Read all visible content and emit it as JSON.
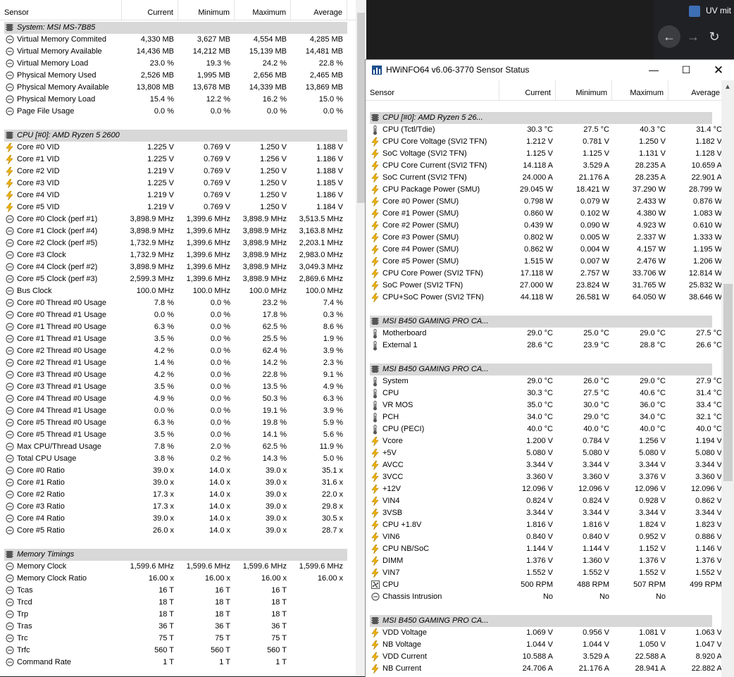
{
  "colors": {
    "group_bg": "#d8d8d8",
    "volt_icon": "#f0b400",
    "temp_icon": "#555555"
  },
  "browser": {
    "tab_title": "UV mit"
  },
  "winA": {
    "headers": [
      "Sensor",
      "Current",
      "Minimum",
      "Maximum",
      "Average"
    ],
    "rows": [
      {
        "t": "g",
        "icon": "chip-icon",
        "s": "System: MSI MS-7B85"
      },
      {
        "icon": "circle-icon",
        "s": "Virtual Memory Commited",
        "v": [
          "4,330 MB",
          "3,627 MB",
          "4,554 MB",
          "4,285 MB"
        ]
      },
      {
        "icon": "circle-icon",
        "s": "Virtual Memory Available",
        "v": [
          "14,436 MB",
          "14,212 MB",
          "15,139 MB",
          "14,481 MB"
        ]
      },
      {
        "icon": "circle-icon",
        "s": "Virtual Memory Load",
        "v": [
          "23.0 %",
          "19.3 %",
          "24.2 %",
          "22.8 %"
        ]
      },
      {
        "icon": "circle-icon",
        "s": "Physical Memory Used",
        "v": [
          "2,526 MB",
          "1,995 MB",
          "2,656 MB",
          "2,465 MB"
        ]
      },
      {
        "icon": "circle-icon",
        "s": "Physical Memory Available",
        "v": [
          "13,808 MB",
          "13,678 MB",
          "14,339 MB",
          "13,869 MB"
        ]
      },
      {
        "icon": "circle-icon",
        "s": "Physical Memory Load",
        "v": [
          "15.4 %",
          "12.2 %",
          "16.2 %",
          "15.0 %"
        ]
      },
      {
        "icon": "circle-icon",
        "s": "Page File Usage",
        "v": [
          "0.0 %",
          "0.0 %",
          "0.0 %",
          "0.0 %"
        ]
      },
      {
        "t": "b"
      },
      {
        "t": "g",
        "icon": "chip-icon",
        "s": "CPU [#0]: AMD Ryzen 5 2600"
      },
      {
        "icon": "bolt-icon",
        "s": "Core #0 VID",
        "v": [
          "1.225 V",
          "0.769 V",
          "1.250 V",
          "1.188 V"
        ]
      },
      {
        "icon": "bolt-icon",
        "s": "Core #1 VID",
        "v": [
          "1.225 V",
          "0.769 V",
          "1.256 V",
          "1.186 V"
        ]
      },
      {
        "icon": "bolt-icon",
        "s": "Core #2 VID",
        "v": [
          "1.219 V",
          "0.769 V",
          "1.250 V",
          "1.188 V"
        ]
      },
      {
        "icon": "bolt-icon",
        "s": "Core #3 VID",
        "v": [
          "1.225 V",
          "0.769 V",
          "1.250 V",
          "1.185 V"
        ]
      },
      {
        "icon": "bolt-icon",
        "s": "Core #4 VID",
        "v": [
          "1.219 V",
          "0.769 V",
          "1.250 V",
          "1.186 V"
        ]
      },
      {
        "icon": "bolt-icon",
        "s": "Core #5 VID",
        "v": [
          "1.219 V",
          "0.769 V",
          "1.250 V",
          "1.184 V"
        ]
      },
      {
        "icon": "circle-icon",
        "s": "Core #0 Clock (perf #1)",
        "v": [
          "3,898.9 MHz",
          "1,399.6 MHz",
          "3,898.9 MHz",
          "3,513.5 MHz"
        ]
      },
      {
        "icon": "circle-icon",
        "s": "Core #1 Clock (perf #4)",
        "v": [
          "3,898.9 MHz",
          "1,399.6 MHz",
          "3,898.9 MHz",
          "3,163.8 MHz"
        ]
      },
      {
        "icon": "circle-icon",
        "s": "Core #2 Clock (perf #5)",
        "v": [
          "1,732.9 MHz",
          "1,399.6 MHz",
          "3,898.9 MHz",
          "2,203.1 MHz"
        ]
      },
      {
        "icon": "circle-icon",
        "s": "Core #3 Clock",
        "v": [
          "1,732.9 MHz",
          "1,399.6 MHz",
          "3,898.9 MHz",
          "2,983.0 MHz"
        ]
      },
      {
        "icon": "circle-icon",
        "s": "Core #4 Clock (perf #2)",
        "v": [
          "3,898.9 MHz",
          "1,399.6 MHz",
          "3,898.9 MHz",
          "3,049.3 MHz"
        ]
      },
      {
        "icon": "circle-icon",
        "s": "Core #5 Clock (perf #3)",
        "v": [
          "2,599.3 MHz",
          "1,399.6 MHz",
          "3,898.9 MHz",
          "2,869.6 MHz"
        ]
      },
      {
        "icon": "circle-icon",
        "s": "Bus Clock",
        "v": [
          "100.0 MHz",
          "100.0 MHz",
          "100.0 MHz",
          "100.0 MHz"
        ]
      },
      {
        "icon": "circle-icon",
        "s": "Core #0 Thread #0 Usage",
        "v": [
          "7.8 %",
          "0.0 %",
          "23.2 %",
          "7.4 %"
        ]
      },
      {
        "icon": "circle-icon",
        "s": "Core #0 Thread #1 Usage",
        "v": [
          "0.0 %",
          "0.0 %",
          "17.8 %",
          "0.3 %"
        ]
      },
      {
        "icon": "circle-icon",
        "s": "Core #1 Thread #0 Usage",
        "v": [
          "6.3 %",
          "0.0 %",
          "62.5 %",
          "8.6 %"
        ]
      },
      {
        "icon": "circle-icon",
        "s": "Core #1 Thread #1 Usage",
        "v": [
          "3.5 %",
          "0.0 %",
          "25.5 %",
          "1.9 %"
        ]
      },
      {
        "icon": "circle-icon",
        "s": "Core #2 Thread #0 Usage",
        "v": [
          "4.2 %",
          "0.0 %",
          "62.4 %",
          "3.9 %"
        ]
      },
      {
        "icon": "circle-icon",
        "s": "Core #2 Thread #1 Usage",
        "v": [
          "1.4 %",
          "0.0 %",
          "14.2 %",
          "2.3 %"
        ]
      },
      {
        "icon": "circle-icon",
        "s": "Core #3 Thread #0 Usage",
        "v": [
          "4.2 %",
          "0.0 %",
          "22.8 %",
          "9.1 %"
        ]
      },
      {
        "icon": "circle-icon",
        "s": "Core #3 Thread #1 Usage",
        "v": [
          "3.5 %",
          "0.0 %",
          "13.5 %",
          "4.9 %"
        ]
      },
      {
        "icon": "circle-icon",
        "s": "Core #4 Thread #0 Usage",
        "v": [
          "4.9 %",
          "0.0 %",
          "50.3 %",
          "6.3 %"
        ]
      },
      {
        "icon": "circle-icon",
        "s": "Core #4 Thread #1 Usage",
        "v": [
          "0.0 %",
          "0.0 %",
          "19.1 %",
          "3.9 %"
        ]
      },
      {
        "icon": "circle-icon",
        "s": "Core #5 Thread #0 Usage",
        "v": [
          "6.3 %",
          "0.0 %",
          "19.8 %",
          "5.9 %"
        ]
      },
      {
        "icon": "circle-icon",
        "s": "Core #5 Thread #1 Usage",
        "v": [
          "3.5 %",
          "0.0 %",
          "14.1 %",
          "5.6 %"
        ]
      },
      {
        "icon": "circle-icon",
        "s": "Max CPU/Thread Usage",
        "v": [
          "7.8 %",
          "2.0 %",
          "62.5 %",
          "11.9 %"
        ]
      },
      {
        "icon": "circle-icon",
        "s": "Total CPU Usage",
        "v": [
          "3.8 %",
          "0.2 %",
          "14.3 %",
          "5.0 %"
        ]
      },
      {
        "icon": "circle-icon",
        "s": "Core #0 Ratio",
        "v": [
          "39.0 x",
          "14.0 x",
          "39.0 x",
          "35.1 x"
        ]
      },
      {
        "icon": "circle-icon",
        "s": "Core #1 Ratio",
        "v": [
          "39.0 x",
          "14.0 x",
          "39.0 x",
          "31.6 x"
        ]
      },
      {
        "icon": "circle-icon",
        "s": "Core #2 Ratio",
        "v": [
          "17.3 x",
          "14.0 x",
          "39.0 x",
          "22.0 x"
        ]
      },
      {
        "icon": "circle-icon",
        "s": "Core #3 Ratio",
        "v": [
          "17.3 x",
          "14.0 x",
          "39.0 x",
          "29.8 x"
        ]
      },
      {
        "icon": "circle-icon",
        "s": "Core #4 Ratio",
        "v": [
          "39.0 x",
          "14.0 x",
          "39.0 x",
          "30.5 x"
        ]
      },
      {
        "icon": "circle-icon",
        "s": "Core #5 Ratio",
        "v": [
          "26.0 x",
          "14.0 x",
          "39.0 x",
          "28.7 x"
        ]
      },
      {
        "t": "b"
      },
      {
        "t": "g",
        "icon": "chip-icon",
        "s": "Memory Timings"
      },
      {
        "icon": "circle-icon",
        "s": "Memory Clock",
        "v": [
          "1,599.6 MHz",
          "1,599.6 MHz",
          "1,599.6 MHz",
          "1,599.6 MHz"
        ]
      },
      {
        "icon": "circle-icon",
        "s": "Memory Clock Ratio",
        "v": [
          "16.00 x",
          "16.00 x",
          "16.00 x",
          "16.00 x"
        ]
      },
      {
        "icon": "circle-icon",
        "s": "Tcas",
        "v": [
          "16 T",
          "16 T",
          "16 T",
          ""
        ]
      },
      {
        "icon": "circle-icon",
        "s": "Trcd",
        "v": [
          "18 T",
          "18 T",
          "18 T",
          ""
        ]
      },
      {
        "icon": "circle-icon",
        "s": "Trp",
        "v": [
          "18 T",
          "18 T",
          "18 T",
          ""
        ]
      },
      {
        "icon": "circle-icon",
        "s": "Tras",
        "v": [
          "36 T",
          "36 T",
          "36 T",
          ""
        ]
      },
      {
        "icon": "circle-icon",
        "s": "Trc",
        "v": [
          "75 T",
          "75 T",
          "75 T",
          ""
        ]
      },
      {
        "icon": "circle-icon",
        "s": "Trfc",
        "v": [
          "560 T",
          "560 T",
          "560 T",
          ""
        ]
      },
      {
        "icon": "circle-icon",
        "s": "Command Rate",
        "v": [
          "1 T",
          "1 T",
          "1 T",
          ""
        ]
      }
    ]
  },
  "winB": {
    "title": "HWiNFO64 v6.06-3770 Sensor Status",
    "headers": [
      "Sensor",
      "Current",
      "Minimum",
      "Maximum",
      "Average"
    ],
    "rows": [
      {
        "t": "g",
        "icon": "chip-icon",
        "s": "CPU [#0]: AMD Ryzen 5 26..."
      },
      {
        "icon": "thermometer-icon",
        "s": "CPU (Tctl/Tdie)",
        "v": [
          "30.3 °C",
          "27.5 °C",
          "40.3 °C",
          "31.4 °C"
        ]
      },
      {
        "icon": "bolt-icon",
        "s": "CPU Core Voltage (SVI2 TFN)",
        "v": [
          "1.212 V",
          "0.781 V",
          "1.250 V",
          "1.182 V"
        ]
      },
      {
        "icon": "bolt-icon",
        "s": "SoC Voltage (SVI2 TFN)",
        "v": [
          "1.125 V",
          "1.125 V",
          "1.131 V",
          "1.128 V"
        ]
      },
      {
        "icon": "bolt-icon",
        "s": "CPU Core Current (SVI2 TFN)",
        "v": [
          "14.118 A",
          "3.529 A",
          "28.235 A",
          "10.659 A"
        ]
      },
      {
        "icon": "bolt-icon",
        "s": "SoC Current (SVI2 TFN)",
        "v": [
          "24.000 A",
          "21.176 A",
          "28.235 A",
          "22.901 A"
        ]
      },
      {
        "icon": "bolt-icon",
        "s": "CPU Package Power (SMU)",
        "v": [
          "29.045 W",
          "18.421 W",
          "37.290 W",
          "28.799 W"
        ]
      },
      {
        "icon": "bolt-icon",
        "s": "Core #0 Power (SMU)",
        "v": [
          "0.798 W",
          "0.079 W",
          "2.433 W",
          "0.876 W"
        ]
      },
      {
        "icon": "bolt-icon",
        "s": "Core #1 Power (SMU)",
        "v": [
          "0.860 W",
          "0.102 W",
          "4.380 W",
          "1.083 W"
        ]
      },
      {
        "icon": "bolt-icon",
        "s": "Core #2 Power (SMU)",
        "v": [
          "0.439 W",
          "0.090 W",
          "4.923 W",
          "0.610 W"
        ]
      },
      {
        "icon": "bolt-icon",
        "s": "Core #3 Power (SMU)",
        "v": [
          "0.802 W",
          "0.005 W",
          "2.337 W",
          "1.333 W"
        ]
      },
      {
        "icon": "bolt-icon",
        "s": "Core #4 Power (SMU)",
        "v": [
          "0.862 W",
          "0.004 W",
          "4.157 W",
          "1.195 W"
        ]
      },
      {
        "icon": "bolt-icon",
        "s": "Core #5 Power (SMU)",
        "v": [
          "1.515 W",
          "0.007 W",
          "2.476 W",
          "1.206 W"
        ]
      },
      {
        "icon": "bolt-icon",
        "s": "CPU Core Power (SVI2 TFN)",
        "v": [
          "17.118 W",
          "2.757 W",
          "33.706 W",
          "12.814 W"
        ]
      },
      {
        "icon": "bolt-icon",
        "s": "SoC Power (SVI2 TFN)",
        "v": [
          "27.000 W",
          "23.824 W",
          "31.765 W",
          "25.832 W"
        ]
      },
      {
        "icon": "bolt-icon",
        "s": "CPU+SoC Power (SVI2 TFN)",
        "v": [
          "44.118 W",
          "26.581 W",
          "64.050 W",
          "38.646 W"
        ]
      },
      {
        "t": "b"
      },
      {
        "t": "g",
        "icon": "chip-icon",
        "s": "MSI B450 GAMING PRO CA..."
      },
      {
        "icon": "thermometer-icon",
        "s": "Motherboard",
        "v": [
          "29.0 °C",
          "25.0 °C",
          "29.0 °C",
          "27.5 °C"
        ]
      },
      {
        "icon": "thermometer-icon",
        "s": "External 1",
        "v": [
          "28.6 °C",
          "23.9 °C",
          "28.8 °C",
          "26.6 °C"
        ]
      },
      {
        "t": "b"
      },
      {
        "t": "g",
        "icon": "chip-icon",
        "s": "MSI B450 GAMING PRO CA..."
      },
      {
        "icon": "thermometer-icon",
        "s": "System",
        "v": [
          "29.0 °C",
          "26.0 °C",
          "29.0 °C",
          "27.9 °C"
        ]
      },
      {
        "icon": "thermometer-icon",
        "s": "CPU",
        "v": [
          "30.3 °C",
          "27.5 °C",
          "40.6 °C",
          "31.4 °C"
        ]
      },
      {
        "icon": "thermometer-icon",
        "s": "VR MOS",
        "v": [
          "35.0 °C",
          "30.0 °C",
          "36.0 °C",
          "33.4 °C"
        ]
      },
      {
        "icon": "thermometer-icon",
        "s": "PCH",
        "v": [
          "34.0 °C",
          "29.0 °C",
          "34.0 °C",
          "32.1 °C"
        ]
      },
      {
        "icon": "thermometer-icon",
        "s": "CPU (PECI)",
        "v": [
          "40.0 °C",
          "40.0 °C",
          "40.0 °C",
          "40.0 °C"
        ]
      },
      {
        "icon": "bolt-icon",
        "s": "Vcore",
        "v": [
          "1.200 V",
          "0.784 V",
          "1.256 V",
          "1.194 V"
        ]
      },
      {
        "icon": "bolt-icon",
        "s": "+5V",
        "v": [
          "5.080 V",
          "5.080 V",
          "5.080 V",
          "5.080 V"
        ]
      },
      {
        "icon": "bolt-icon",
        "s": "AVCC",
        "v": [
          "3.344 V",
          "3.344 V",
          "3.344 V",
          "3.344 V"
        ]
      },
      {
        "icon": "bolt-icon",
        "s": "3VCC",
        "v": [
          "3.360 V",
          "3.360 V",
          "3.376 V",
          "3.360 V"
        ]
      },
      {
        "icon": "bolt-icon",
        "s": "+12V",
        "v": [
          "12.096 V",
          "12.096 V",
          "12.096 V",
          "12.096 V"
        ]
      },
      {
        "icon": "bolt-icon",
        "s": "VIN4",
        "v": [
          "0.824 V",
          "0.824 V",
          "0.928 V",
          "0.862 V"
        ]
      },
      {
        "icon": "bolt-icon",
        "s": "3VSB",
        "v": [
          "3.344 V",
          "3.344 V",
          "3.344 V",
          "3.344 V"
        ]
      },
      {
        "icon": "bolt-icon",
        "s": "CPU +1.8V",
        "v": [
          "1.816 V",
          "1.816 V",
          "1.824 V",
          "1.823 V"
        ]
      },
      {
        "icon": "bolt-icon",
        "s": "VIN6",
        "v": [
          "0.840 V",
          "0.840 V",
          "0.952 V",
          "0.886 V"
        ]
      },
      {
        "icon": "bolt-icon",
        "s": "CPU NB/SoC",
        "v": [
          "1.144 V",
          "1.144 V",
          "1.152 V",
          "1.146 V"
        ]
      },
      {
        "icon": "bolt-icon",
        "s": "DIMM",
        "v": [
          "1.376 V",
          "1.360 V",
          "1.376 V",
          "1.376 V"
        ]
      },
      {
        "icon": "bolt-icon",
        "s": "VIN7",
        "v": [
          "1.552 V",
          "1.552 V",
          "1.552 V",
          "1.552 V"
        ]
      },
      {
        "icon": "fan-icon",
        "s": "CPU",
        "v": [
          "500 RPM",
          "488 RPM",
          "507 RPM",
          "499 RPM"
        ]
      },
      {
        "icon": "circle-icon",
        "s": "Chassis Intrusion",
        "v": [
          "No",
          "No",
          "No",
          ""
        ]
      },
      {
        "t": "b"
      },
      {
        "t": "g",
        "icon": "chip-icon",
        "s": "MSI B450 GAMING PRO CA..."
      },
      {
        "icon": "bolt-icon",
        "s": "VDD Voltage",
        "v": [
          "1.069 V",
          "0.956 V",
          "1.081 V",
          "1.063 V"
        ]
      },
      {
        "icon": "bolt-icon",
        "s": "NB Voltage",
        "v": [
          "1.044 V",
          "1.044 V",
          "1.050 V",
          "1.047 V"
        ]
      },
      {
        "icon": "bolt-icon",
        "s": "VDD Current",
        "v": [
          "10.588 A",
          "3.529 A",
          "22.588 A",
          "8.920 A"
        ]
      },
      {
        "icon": "bolt-icon",
        "s": "NB Current",
        "v": [
          "24.706 A",
          "21.176 A",
          "28.941 A",
          "22.882 A"
        ]
      }
    ]
  }
}
